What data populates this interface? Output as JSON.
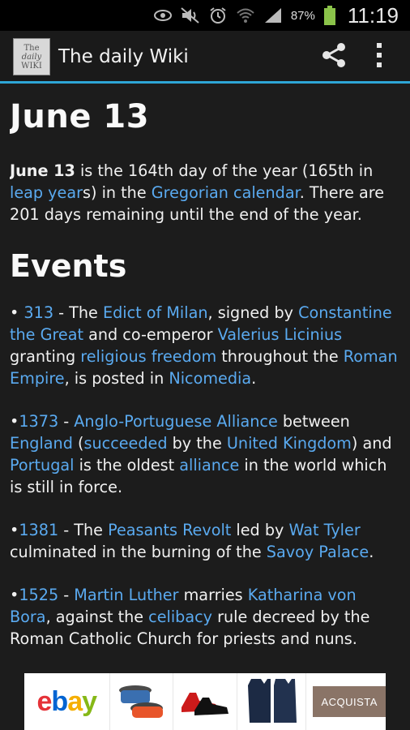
{
  "status_bar": {
    "battery_pct": "87%",
    "time": "11:19",
    "icons": [
      "eye-icon",
      "mute-icon",
      "alarm-icon",
      "wifi-icon",
      "signal-icon",
      "battery-icon"
    ]
  },
  "app_bar": {
    "logo_line1": "The",
    "logo_line2": "daily",
    "logo_line3": "WIKI",
    "title": "The daily Wiki",
    "icons": [
      "share-icon",
      "overflow-menu-icon"
    ],
    "accent": "#2ea6d6"
  },
  "article": {
    "title": "June 13",
    "intro": {
      "bold": "June 13",
      "t1": " is the 164th day of the year (165th in ",
      "l1": "leap year",
      "t2": "s) in the ",
      "l2": "Gregorian calendar",
      "t3": ". There are 201 days remaining until the end of the year."
    },
    "section_title": "Events",
    "events": [
      {
        "prefix": "• ",
        "year": "313",
        "segments": [
          {
            "t": " - The "
          },
          {
            "l": "Edict of Milan"
          },
          {
            "t": ", signed by "
          },
          {
            "l": "Constantine the Great"
          },
          {
            "t": " and co-emperor "
          },
          {
            "l": "Valerius Licinius"
          },
          {
            "t": " granting "
          },
          {
            "l": "religious freedom"
          },
          {
            "t": " throughout the "
          },
          {
            "l": "Roman Empire"
          },
          {
            "t": ", is posted in "
          },
          {
            "l": "Nicomedia"
          },
          {
            "t": "."
          }
        ]
      },
      {
        "prefix": "•",
        "year": "1373",
        "segments": [
          {
            "t": " - "
          },
          {
            "l": "Anglo-Portuguese Alliance"
          },
          {
            "t": " between "
          },
          {
            "l": "England"
          },
          {
            "t": " ("
          },
          {
            "l": "succeeded"
          },
          {
            "t": " by the "
          },
          {
            "l": "United Kingdom"
          },
          {
            "t": ") and "
          },
          {
            "l": "Portugal"
          },
          {
            "t": " is the oldest "
          },
          {
            "l": "alliance"
          },
          {
            "t": " in the world which is still in force."
          }
        ]
      },
      {
        "prefix": "•",
        "year": "1381",
        "segments": [
          {
            "t": " - The "
          },
          {
            "l": "Peasants Revolt"
          },
          {
            "t": " led by "
          },
          {
            "l": "Wat Tyler"
          },
          {
            "t": " culminated in the burning of the "
          },
          {
            "l": "Savoy Palace"
          },
          {
            "t": "."
          }
        ]
      },
      {
        "prefix": "•",
        "year": "1525",
        "segments": [
          {
            "t": " - "
          },
          {
            "l": "Martin Luther"
          },
          {
            "t": " marries "
          },
          {
            "l": "Katharina von Bora"
          },
          {
            "t": ", against the "
          },
          {
            "l": "celibacy"
          },
          {
            "t": " rule decreed by the Roman Catholic Church for priests and nuns."
          }
        ]
      }
    ],
    "link_color": "#5aaaf0"
  },
  "ad": {
    "brand_letters": [
      "e",
      "b",
      "a",
      "y"
    ],
    "brand_colors": [
      "#e53238",
      "#0064d2",
      "#f5af02",
      "#86b817"
    ],
    "products": [
      "cookware-icon",
      "shoes-icon",
      "coat-icon"
    ],
    "cta": "ACQUISTA"
  }
}
